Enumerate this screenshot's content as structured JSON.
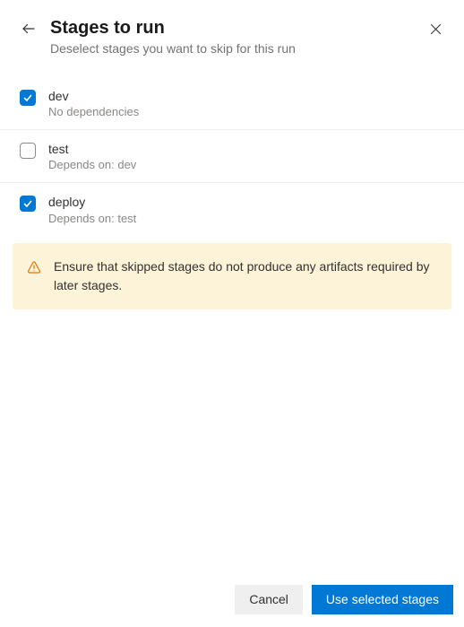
{
  "header": {
    "title": "Stages to run",
    "subtitle": "Deselect stages you want to skip for this run"
  },
  "stages": [
    {
      "name": "dev",
      "dependency": "No dependencies",
      "checked": true
    },
    {
      "name": "test",
      "dependency": "Depends on: dev",
      "checked": false
    },
    {
      "name": "deploy",
      "dependency": "Depends on: test",
      "checked": true
    }
  ],
  "warning": {
    "text": "Ensure that skipped stages do not produce any artifacts required by later stages."
  },
  "footer": {
    "cancel_label": "Cancel",
    "primary_label": "Use selected stages"
  },
  "colors": {
    "primary": "#0078d4",
    "warning_bg": "#fdf3d8",
    "warning_icon": "#d97706"
  }
}
